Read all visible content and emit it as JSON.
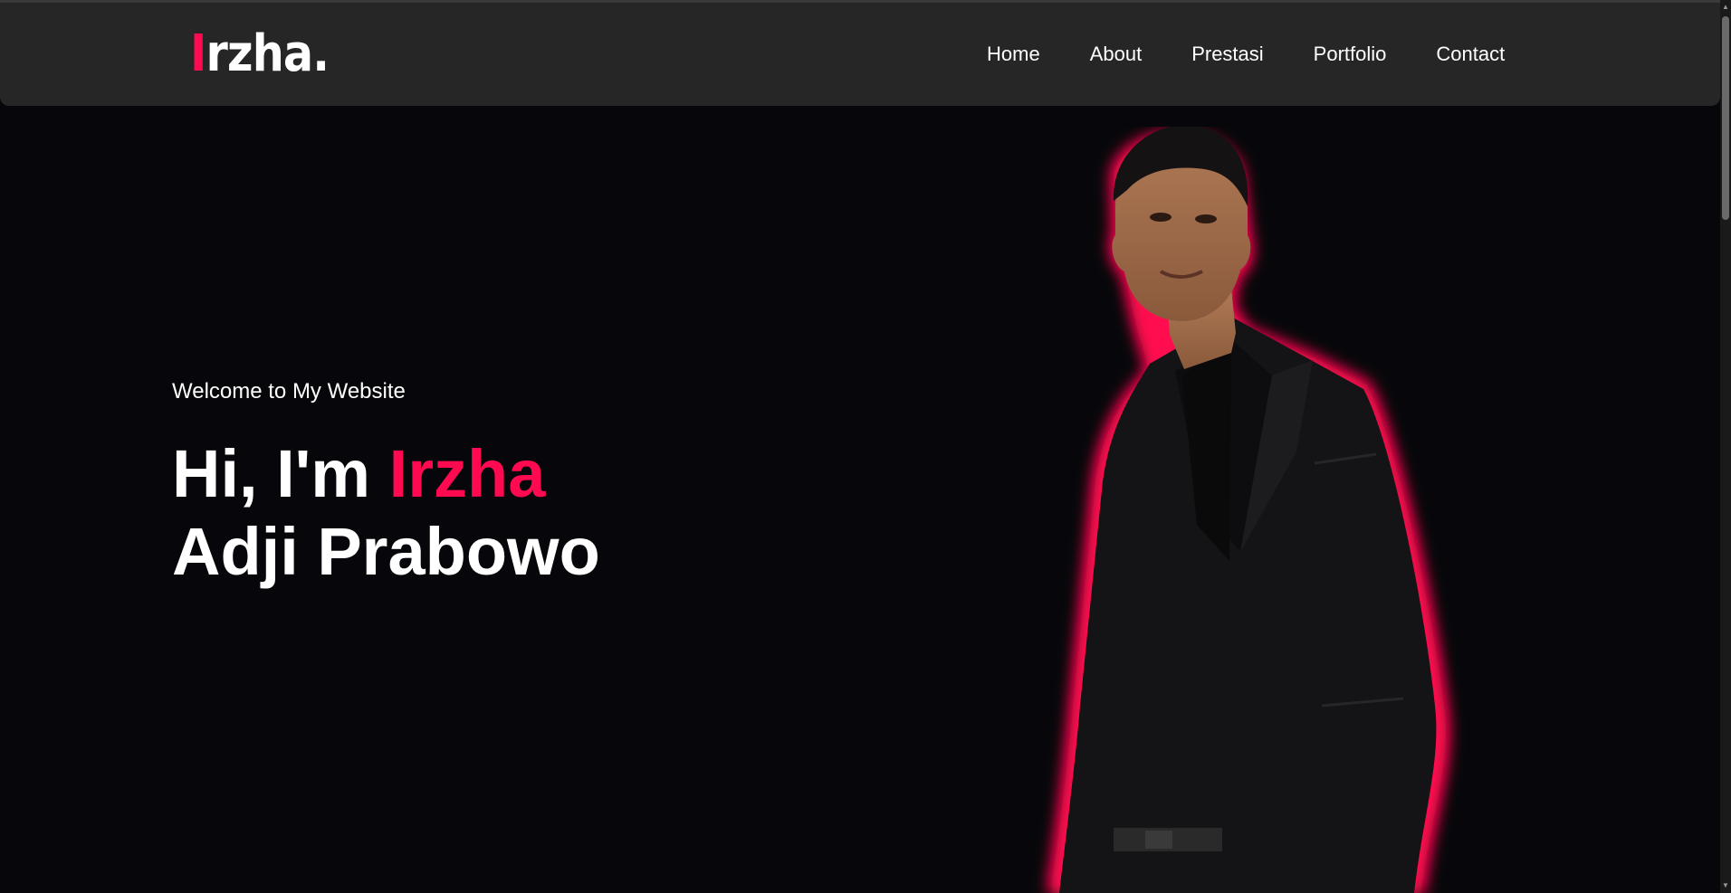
{
  "logo": {
    "accent": "I",
    "rest": "rzha."
  },
  "nav": {
    "items": [
      {
        "label": "Home"
      },
      {
        "label": "About"
      },
      {
        "label": "Prestasi"
      },
      {
        "label": "Portfolio"
      },
      {
        "label": "Contact"
      }
    ]
  },
  "hero": {
    "welcome": "Welcome to My Website",
    "greeting": "Hi, I'm ",
    "first_name": "Irzha",
    "last_name": "Adji Prabowo"
  },
  "colors": {
    "accent": "#ff0a50",
    "background": "#07070b",
    "navbar": "#262626",
    "text": "#ffffff"
  }
}
